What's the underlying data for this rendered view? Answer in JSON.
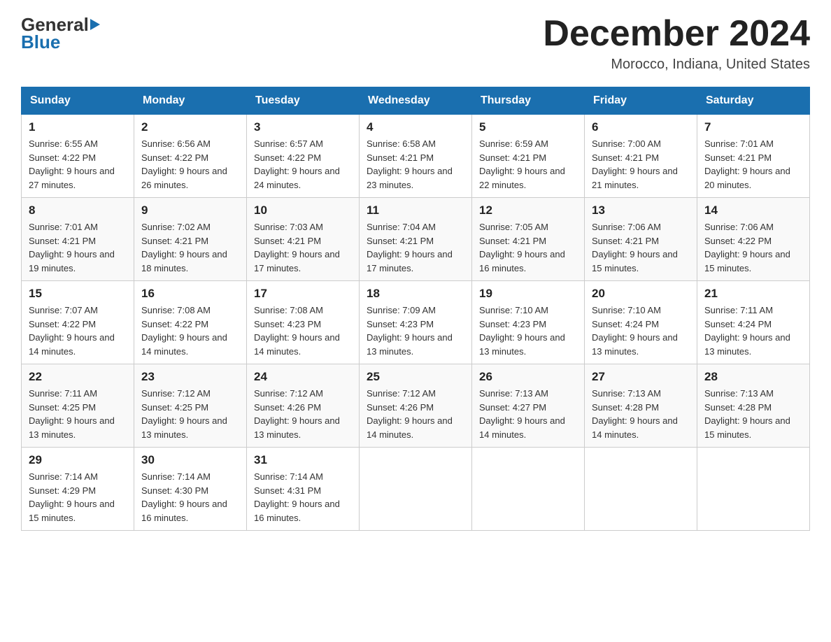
{
  "header": {
    "logo_general": "General",
    "logo_blue": "Blue",
    "month_title": "December 2024",
    "location": "Morocco, Indiana, United States"
  },
  "days_of_week": [
    "Sunday",
    "Monday",
    "Tuesday",
    "Wednesday",
    "Thursday",
    "Friday",
    "Saturday"
  ],
  "weeks": [
    [
      {
        "day": "1",
        "sunrise": "Sunrise: 6:55 AM",
        "sunset": "Sunset: 4:22 PM",
        "daylight": "Daylight: 9 hours and 27 minutes."
      },
      {
        "day": "2",
        "sunrise": "Sunrise: 6:56 AM",
        "sunset": "Sunset: 4:22 PM",
        "daylight": "Daylight: 9 hours and 26 minutes."
      },
      {
        "day": "3",
        "sunrise": "Sunrise: 6:57 AM",
        "sunset": "Sunset: 4:22 PM",
        "daylight": "Daylight: 9 hours and 24 minutes."
      },
      {
        "day": "4",
        "sunrise": "Sunrise: 6:58 AM",
        "sunset": "Sunset: 4:21 PM",
        "daylight": "Daylight: 9 hours and 23 minutes."
      },
      {
        "day": "5",
        "sunrise": "Sunrise: 6:59 AM",
        "sunset": "Sunset: 4:21 PM",
        "daylight": "Daylight: 9 hours and 22 minutes."
      },
      {
        "day": "6",
        "sunrise": "Sunrise: 7:00 AM",
        "sunset": "Sunset: 4:21 PM",
        "daylight": "Daylight: 9 hours and 21 minutes."
      },
      {
        "day": "7",
        "sunrise": "Sunrise: 7:01 AM",
        "sunset": "Sunset: 4:21 PM",
        "daylight": "Daylight: 9 hours and 20 minutes."
      }
    ],
    [
      {
        "day": "8",
        "sunrise": "Sunrise: 7:01 AM",
        "sunset": "Sunset: 4:21 PM",
        "daylight": "Daylight: 9 hours and 19 minutes."
      },
      {
        "day": "9",
        "sunrise": "Sunrise: 7:02 AM",
        "sunset": "Sunset: 4:21 PM",
        "daylight": "Daylight: 9 hours and 18 minutes."
      },
      {
        "day": "10",
        "sunrise": "Sunrise: 7:03 AM",
        "sunset": "Sunset: 4:21 PM",
        "daylight": "Daylight: 9 hours and 17 minutes."
      },
      {
        "day": "11",
        "sunrise": "Sunrise: 7:04 AM",
        "sunset": "Sunset: 4:21 PM",
        "daylight": "Daylight: 9 hours and 17 minutes."
      },
      {
        "day": "12",
        "sunrise": "Sunrise: 7:05 AM",
        "sunset": "Sunset: 4:21 PM",
        "daylight": "Daylight: 9 hours and 16 minutes."
      },
      {
        "day": "13",
        "sunrise": "Sunrise: 7:06 AM",
        "sunset": "Sunset: 4:21 PM",
        "daylight": "Daylight: 9 hours and 15 minutes."
      },
      {
        "day": "14",
        "sunrise": "Sunrise: 7:06 AM",
        "sunset": "Sunset: 4:22 PM",
        "daylight": "Daylight: 9 hours and 15 minutes."
      }
    ],
    [
      {
        "day": "15",
        "sunrise": "Sunrise: 7:07 AM",
        "sunset": "Sunset: 4:22 PM",
        "daylight": "Daylight: 9 hours and 14 minutes."
      },
      {
        "day": "16",
        "sunrise": "Sunrise: 7:08 AM",
        "sunset": "Sunset: 4:22 PM",
        "daylight": "Daylight: 9 hours and 14 minutes."
      },
      {
        "day": "17",
        "sunrise": "Sunrise: 7:08 AM",
        "sunset": "Sunset: 4:23 PM",
        "daylight": "Daylight: 9 hours and 14 minutes."
      },
      {
        "day": "18",
        "sunrise": "Sunrise: 7:09 AM",
        "sunset": "Sunset: 4:23 PM",
        "daylight": "Daylight: 9 hours and 13 minutes."
      },
      {
        "day": "19",
        "sunrise": "Sunrise: 7:10 AM",
        "sunset": "Sunset: 4:23 PM",
        "daylight": "Daylight: 9 hours and 13 minutes."
      },
      {
        "day": "20",
        "sunrise": "Sunrise: 7:10 AM",
        "sunset": "Sunset: 4:24 PM",
        "daylight": "Daylight: 9 hours and 13 minutes."
      },
      {
        "day": "21",
        "sunrise": "Sunrise: 7:11 AM",
        "sunset": "Sunset: 4:24 PM",
        "daylight": "Daylight: 9 hours and 13 minutes."
      }
    ],
    [
      {
        "day": "22",
        "sunrise": "Sunrise: 7:11 AM",
        "sunset": "Sunset: 4:25 PM",
        "daylight": "Daylight: 9 hours and 13 minutes."
      },
      {
        "day": "23",
        "sunrise": "Sunrise: 7:12 AM",
        "sunset": "Sunset: 4:25 PM",
        "daylight": "Daylight: 9 hours and 13 minutes."
      },
      {
        "day": "24",
        "sunrise": "Sunrise: 7:12 AM",
        "sunset": "Sunset: 4:26 PM",
        "daylight": "Daylight: 9 hours and 13 minutes."
      },
      {
        "day": "25",
        "sunrise": "Sunrise: 7:12 AM",
        "sunset": "Sunset: 4:26 PM",
        "daylight": "Daylight: 9 hours and 14 minutes."
      },
      {
        "day": "26",
        "sunrise": "Sunrise: 7:13 AM",
        "sunset": "Sunset: 4:27 PM",
        "daylight": "Daylight: 9 hours and 14 minutes."
      },
      {
        "day": "27",
        "sunrise": "Sunrise: 7:13 AM",
        "sunset": "Sunset: 4:28 PM",
        "daylight": "Daylight: 9 hours and 14 minutes."
      },
      {
        "day": "28",
        "sunrise": "Sunrise: 7:13 AM",
        "sunset": "Sunset: 4:28 PM",
        "daylight": "Daylight: 9 hours and 15 minutes."
      }
    ],
    [
      {
        "day": "29",
        "sunrise": "Sunrise: 7:14 AM",
        "sunset": "Sunset: 4:29 PM",
        "daylight": "Daylight: 9 hours and 15 minutes."
      },
      {
        "day": "30",
        "sunrise": "Sunrise: 7:14 AM",
        "sunset": "Sunset: 4:30 PM",
        "daylight": "Daylight: 9 hours and 16 minutes."
      },
      {
        "day": "31",
        "sunrise": "Sunrise: 7:14 AM",
        "sunset": "Sunset: 4:31 PM",
        "daylight": "Daylight: 9 hours and 16 minutes."
      },
      null,
      null,
      null,
      null
    ]
  ]
}
